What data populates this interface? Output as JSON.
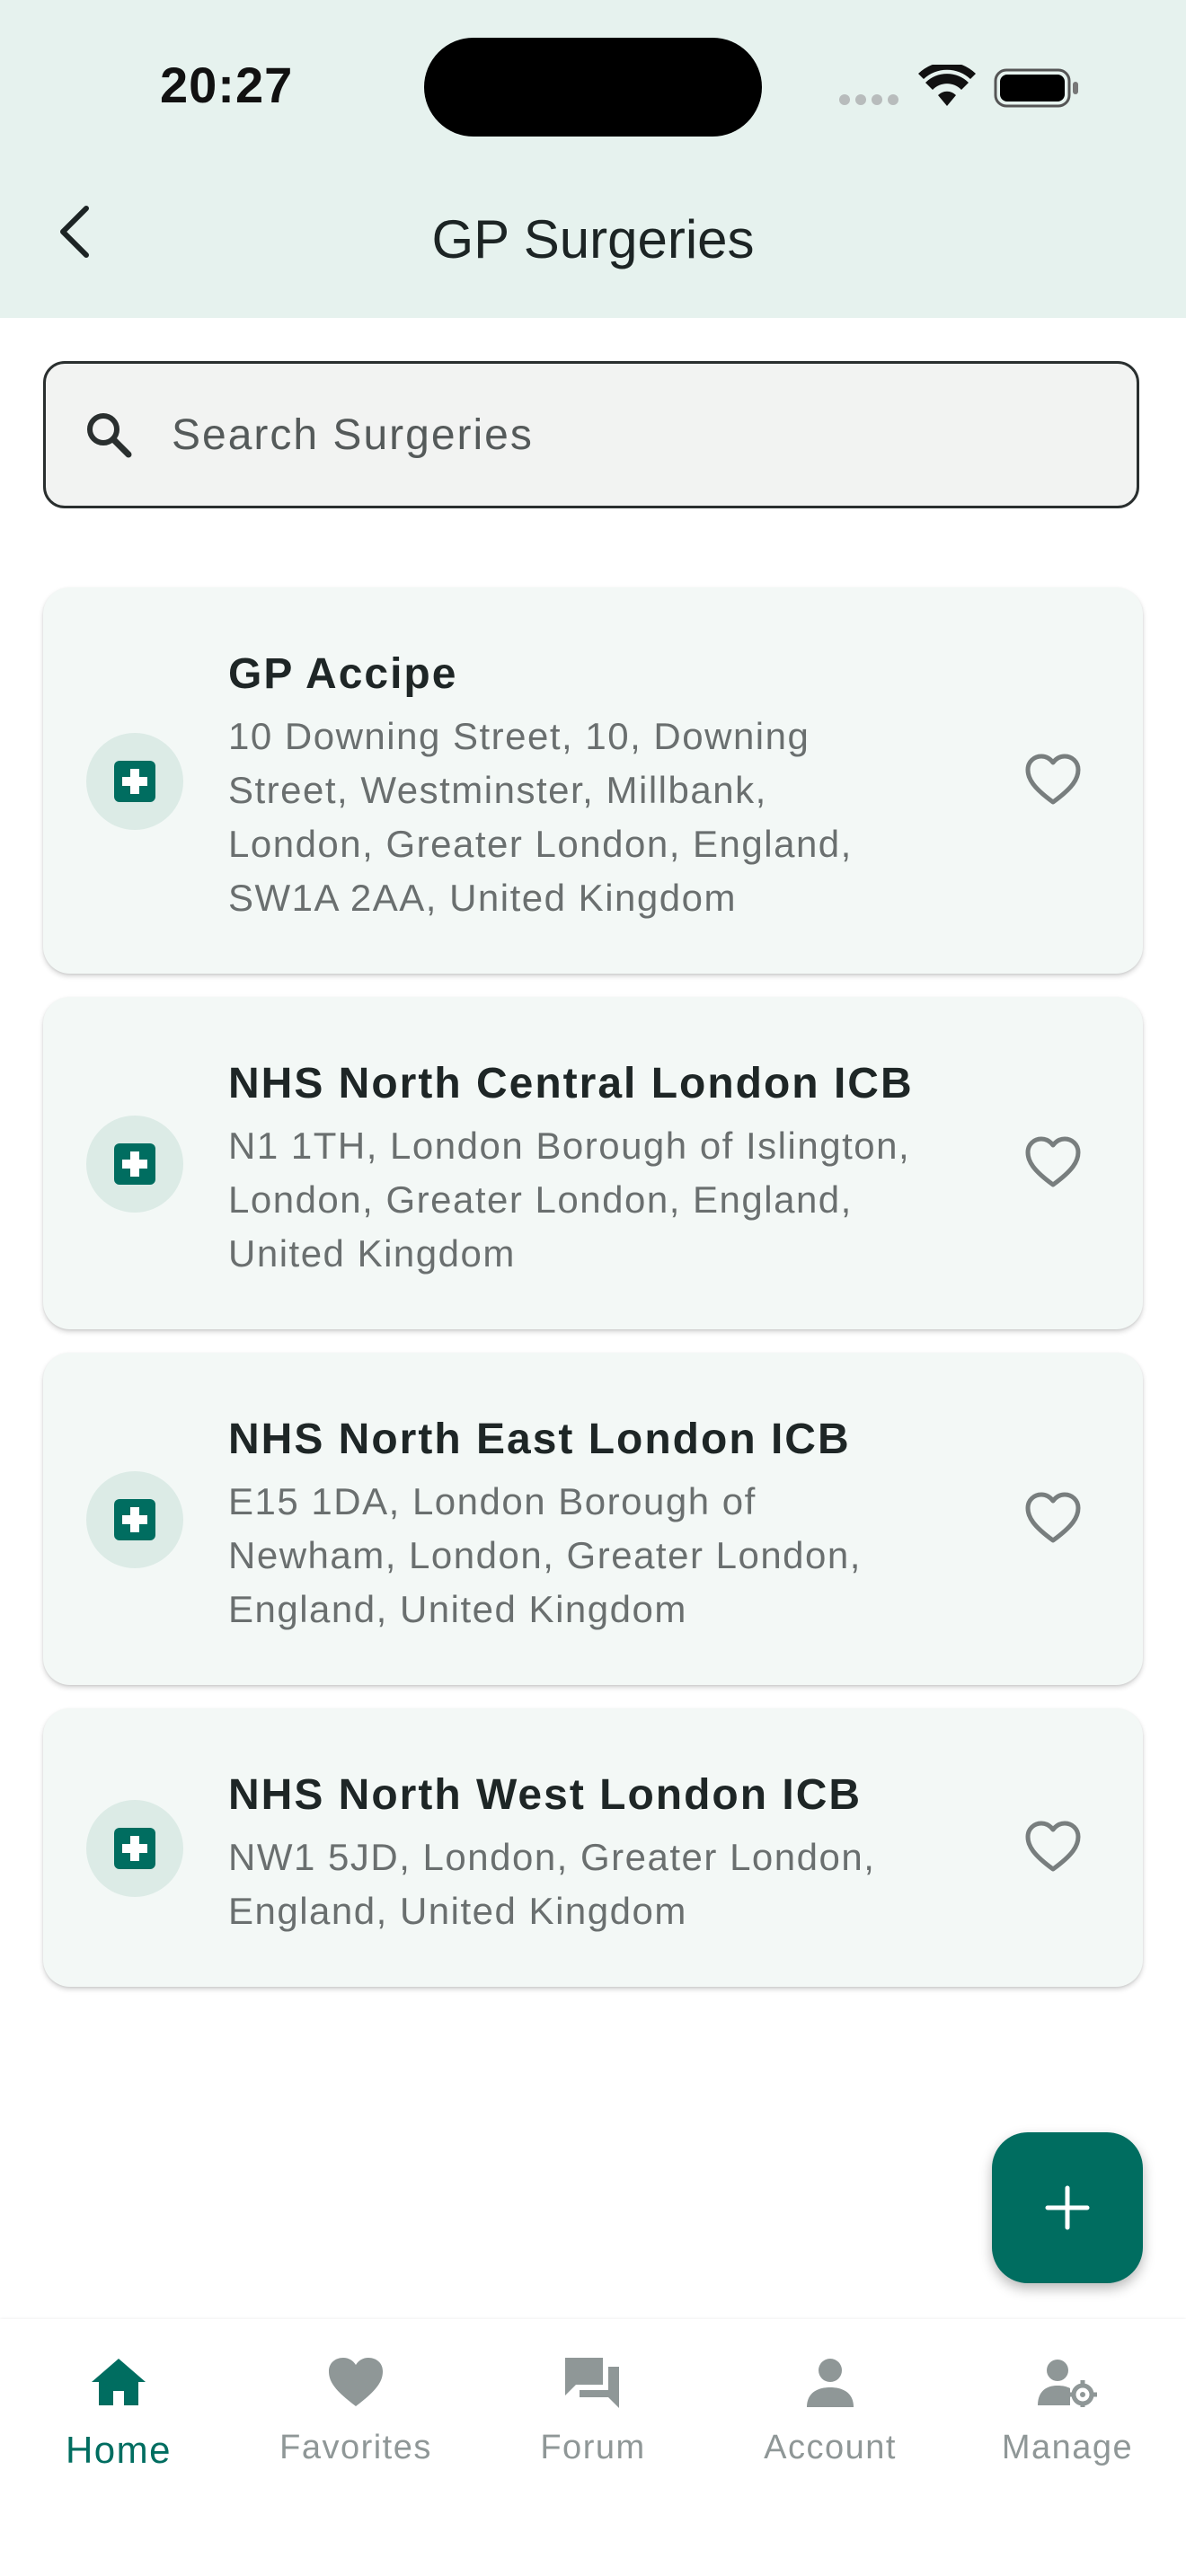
{
  "status_bar": {
    "time": "20:27"
  },
  "app_bar": {
    "title": "GP Surgeries"
  },
  "search": {
    "placeholder": "Search Surgeries"
  },
  "colors": {
    "primary": "#006d60",
    "app_bar_bg": "#e6f2ee",
    "card_bg": "#f3f8f6",
    "inactive": "#8f9797"
  },
  "surgeries": [
    {
      "name": "GP Accipe",
      "address_lines": [
        "10 Downing Street, 10, Downing",
        "Street, Westminster, Millbank,",
        "London, Greater London, England,",
        "SW1A 2AA, United Kingdom"
      ]
    },
    {
      "name": "NHS North Central London ICB",
      "address_lines": [
        "N1 1TH, London Borough of Islington,",
        "London, Greater London, England,",
        "United Kingdom"
      ]
    },
    {
      "name": "NHS North East London ICB",
      "address_lines": [
        "E15 1DA, London Borough of",
        "Newham, London, Greater London,",
        "England, United Kingdom"
      ]
    },
    {
      "name": "NHS North West London ICB",
      "address_lines": [
        "NW1 5JD, London, Greater London,",
        "England, United Kingdom"
      ]
    }
  ],
  "bottom_nav": {
    "items": [
      {
        "label": "Home",
        "icon": "home-icon",
        "active": true
      },
      {
        "label": "Favorites",
        "icon": "heart-icon",
        "active": false
      },
      {
        "label": "Forum",
        "icon": "forum-icon",
        "active": false
      },
      {
        "label": "Account",
        "icon": "account-icon",
        "active": false
      },
      {
        "label": "Manage",
        "icon": "manage-icon",
        "active": false
      }
    ]
  }
}
